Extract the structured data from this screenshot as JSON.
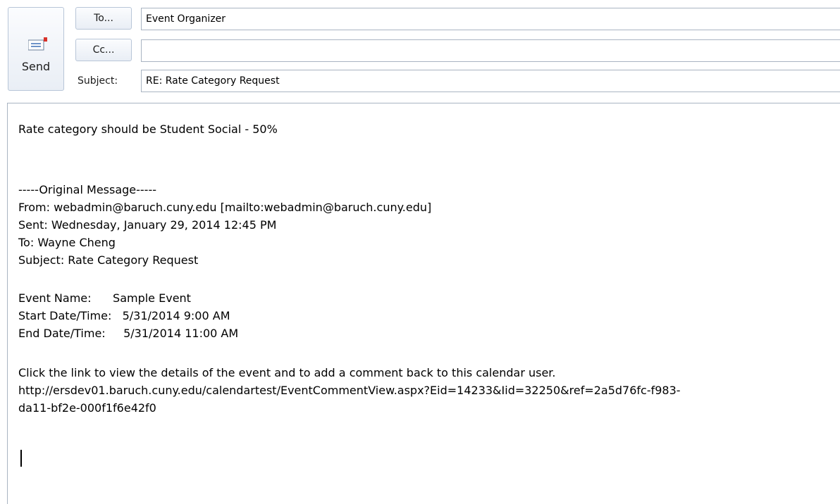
{
  "header": {
    "send_label": "Send",
    "to_button": "To...",
    "cc_button": "Cc...",
    "subject_label": "Subject:",
    "to_value": "Event Organizer",
    "cc_value": "",
    "subject_value": "RE: Rate Category Request"
  },
  "body": {
    "line1": "Rate category should be Student Social - 50%",
    "original_header": "-----Original Message-----",
    "from": "From: webadmin@baruch.cuny.edu [mailto:webadmin@baruch.cuny.edu]",
    "sent": "Sent: Wednesday, January 29, 2014 12:45 PM",
    "to": "To: Wayne Cheng",
    "subject": "Subject: Rate Category Request",
    "event_name": "Event Name:      Sample Event",
    "start": "Start Date/Time:   5/31/2014 9:00 AM",
    "end": "End Date/Time:     5/31/2014 11:00 AM",
    "click_line": "Click the link to view the details of the event and to add a comment back to this calendar user.",
    "link_line1": "http://ersdev01.baruch.cuny.edu/calendartest/EventCommentView.aspx?Eid=14233&Iid=32250&ref=2a5d76fc-f983-",
    "link_line2": "da11-bf2e-000f1f6e42f0"
  }
}
